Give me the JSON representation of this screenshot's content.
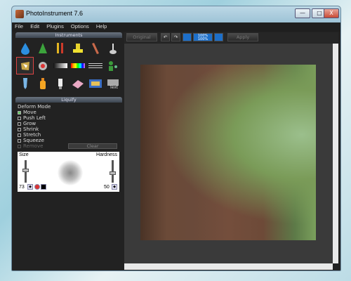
{
  "window": {
    "title": "PhotoInstrument 7.6",
    "minimize": "—",
    "maximize": "□",
    "close": "X"
  },
  "menu": [
    "File",
    "Edit",
    "Plugins",
    "Options",
    "Help"
  ],
  "instruments": {
    "header": "Instruments",
    "tools": [
      "water-drop-icon",
      "cone-icon",
      "brush-pencil-icon",
      "stamp-icon",
      "pencil-icon",
      "spoon-icon",
      "liquify-icon",
      "record-icon",
      "gradient-bar-icon",
      "rainbow-bar-icon",
      "lines-icon",
      "people-icon",
      "tube-icon",
      "bottle-icon",
      "light-icon",
      "eraser-icon",
      "picture-icon",
      "text-icon"
    ],
    "tool_text": "Text"
  },
  "liquify": {
    "header": "Liquify",
    "mode_label": "Deform Mode",
    "options": [
      {
        "label": "Move",
        "checked": true
      },
      {
        "label": "Push Left",
        "checked": false
      },
      {
        "label": "Grow",
        "checked": false
      },
      {
        "label": "Shrink",
        "checked": false
      },
      {
        "label": "Stretch",
        "checked": false
      },
      {
        "label": "Squeeze",
        "checked": false
      },
      {
        "label": "Remove",
        "checked": false,
        "disabled": true
      }
    ],
    "clear": "Clear",
    "size_label": "Size",
    "hardness_label": "Hardness",
    "size_value": "73",
    "hardness_value": "50"
  },
  "toolbar": {
    "original": "Original",
    "zoom_top": "100%",
    "zoom_bottom": "100%",
    "apply": "Apply"
  }
}
